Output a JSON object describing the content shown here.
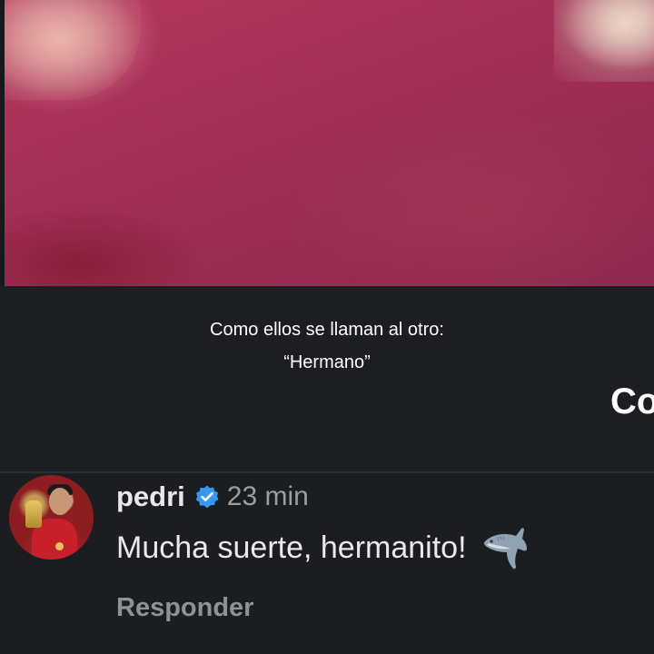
{
  "caption": {
    "line1": "Como ellos se llaman al otro:",
    "line2": "“Hermano”"
  },
  "side_text": "Co",
  "comment": {
    "username": "pedri",
    "verified_icon": "verified-badge-icon",
    "timestamp": "23 min",
    "text": "Mucha suerte, hermanito!",
    "emoji_icon": "shark-icon",
    "reply_label": "Responder"
  },
  "colors": {
    "video_background": "#a52f57",
    "dark_background": "#1b1d21",
    "verified_blue": "#3897f0",
    "secondary_text": "#9b9da3"
  }
}
